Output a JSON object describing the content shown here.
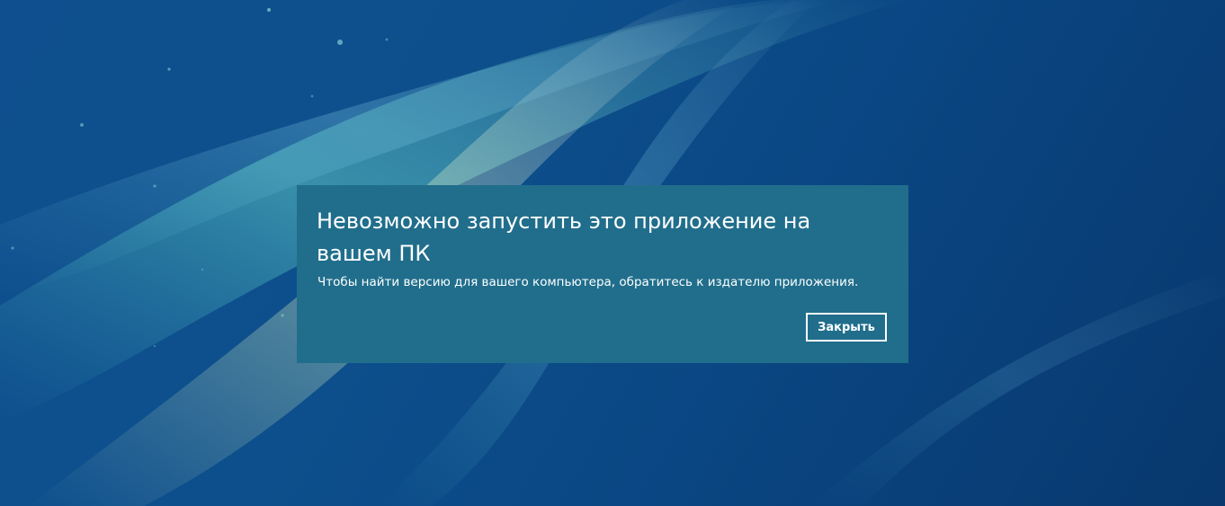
{
  "dialog": {
    "title": "Невозможно запустить это приложение на вашем ПК",
    "message": "Чтобы найти версию для вашего компьютера, обратитесь к издателю приложения.",
    "close_label": "Закрыть"
  },
  "colors": {
    "dialog_background": "#206e8c",
    "desktop_background": "#0d4f8c",
    "text": "#ffffff"
  }
}
